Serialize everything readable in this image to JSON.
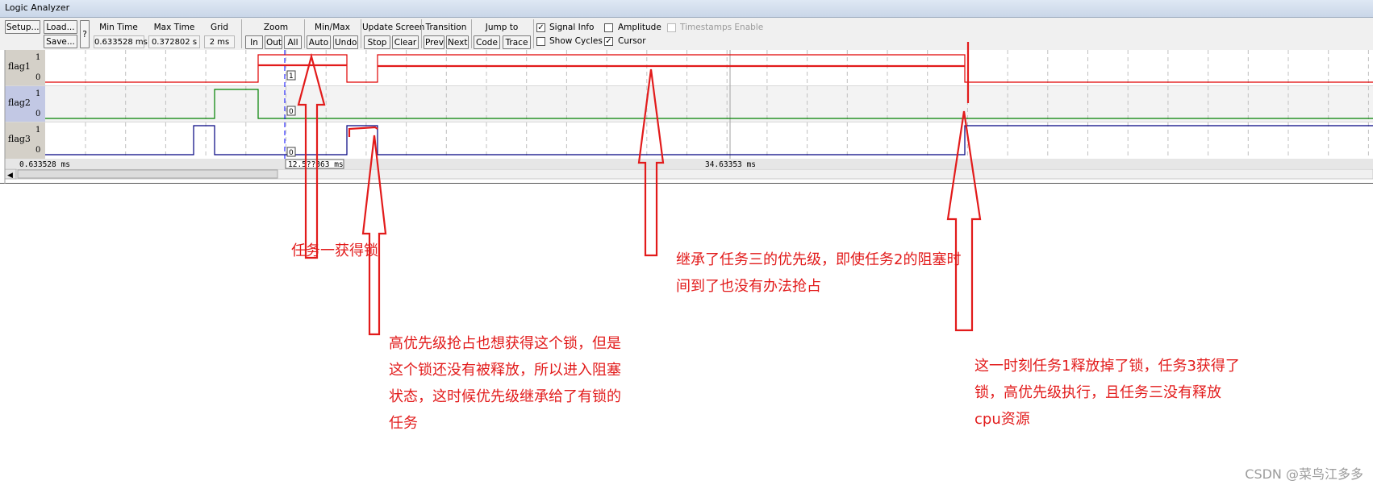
{
  "window": {
    "title": "Logic Analyzer"
  },
  "toolbar": {
    "setup": "Setup...",
    "load": "Load...",
    "save": "Save...",
    "help": "?",
    "min_time_label": "Min Time",
    "min_time_value": "0.633528 ms",
    "max_time_label": "Max Time",
    "max_time_value": "0.372802 s",
    "grid_label": "Grid",
    "grid_value": "2 ms",
    "zoom_label": "Zoom",
    "zoom_in": "In",
    "zoom_out": "Out",
    "zoom_all": "All",
    "minmax_label": "Min/Max",
    "minmax_auto": "Auto",
    "minmax_undo": "Undo",
    "update_label": "Update Screen",
    "update_stop": "Stop",
    "update_clear": "Clear",
    "transition_label": "Transition",
    "transition_prev": "Prev",
    "transition_next": "Next",
    "jump_label": "Jump to",
    "jump_code": "Code",
    "jump_trace": "Trace",
    "signal_info": "Signal Info",
    "signal_info_checked": true,
    "show_cycles": "Show Cycles",
    "show_cycles_checked": false,
    "amplitude": "Amplitude",
    "amplitude_checked": false,
    "cursor": "Cursor",
    "cursor_checked": true,
    "timestamps": "Timestamps Enable",
    "timestamps_checked": false
  },
  "signals": [
    {
      "name": "flag1",
      "high": "1",
      "low": "0",
      "color": "#e00000",
      "value_box": "1"
    },
    {
      "name": "flag2",
      "high": "1",
      "low": "0",
      "color": "#008000",
      "value_box": "0"
    },
    {
      "name": "flag3",
      "high": "1",
      "low": "0",
      "color": "#000080",
      "value_box": "0"
    }
  ],
  "timeline": {
    "left_time": "0.633528 ms",
    "cursor_time": "12.5??363 ms",
    "mid_time": "34.63353 ms"
  },
  "annotations": [
    {
      "lines": [
        "任务一获得锁"
      ]
    },
    {
      "lines": [
        "继承了任务三的优先级，即使任务2的阻塞时",
        "间到了也没有办法抢占"
      ]
    },
    {
      "lines": [
        "高优先级抢占也想获得这个锁，但是",
        "这个锁还没有被释放，所以进入阻塞",
        "状态，这时候优先级继承给了有锁的",
        "任务"
      ]
    },
    {
      "lines": [
        "这一时刻任务1释放掉了锁，任务3获得了",
        "锁，高优先级执行，且任务三没有释放",
        "cpu资源"
      ]
    }
  ],
  "watermark": "CSDN @菜鸟江多多",
  "colors": {
    "annotation": "#e21b1b",
    "grid": "#c0c0c0"
  }
}
